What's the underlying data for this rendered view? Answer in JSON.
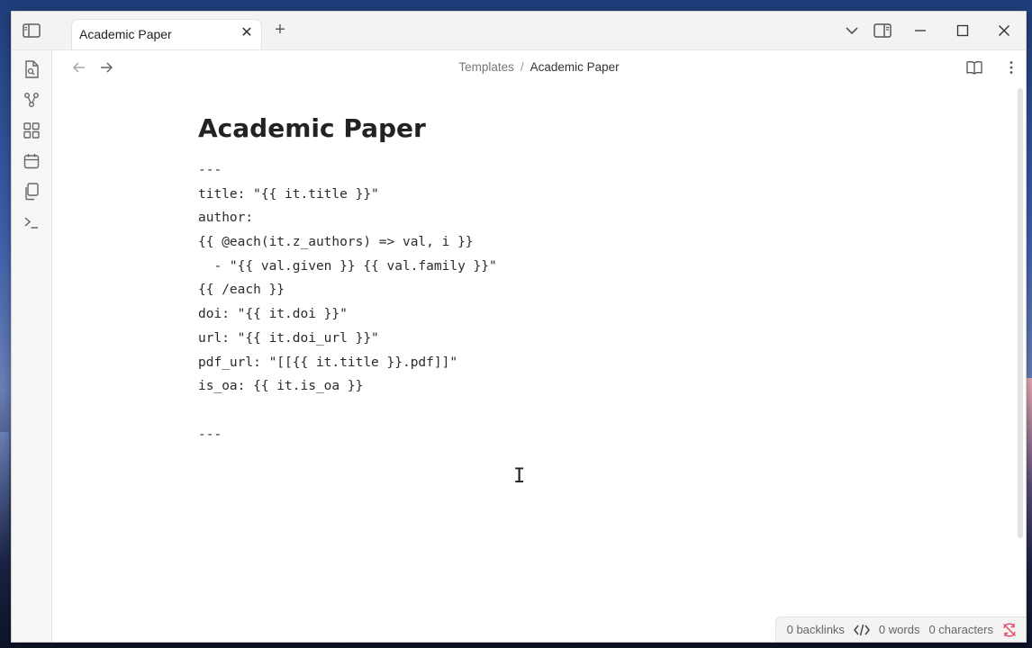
{
  "window": {
    "tab_title": "Academic Paper",
    "tab_close_glyph": "✕",
    "new_tab_glyph": "+"
  },
  "navigation": {
    "breadcrumb": {
      "parent": "Templates",
      "separator": "/",
      "current": "Academic Paper"
    }
  },
  "document": {
    "title": "Academic Paper",
    "lines": [
      "---",
      "title: \"{{ it.title }}\"",
      "author:",
      "{{ @each(it.z_authors) => val, i }}",
      "  - \"{{ val.given }} {{ val.family }}\"",
      "{{ /each }}",
      "doi: \"{{ it.doi }}\"",
      "url: \"{{ it.doi_url }}\"",
      "pdf_url: \"[[{{ it.title }}.pdf]]\"",
      "is_oa: {{ it.is_oa }}",
      "",
      "---"
    ]
  },
  "statusbar": {
    "backlinks": "0 backlinks",
    "words": "0 words",
    "characters": "0 characters"
  },
  "icons": {
    "ribbon": [
      "open-file-icon",
      "graph-icon",
      "canvas-icon",
      "calendar-icon",
      "copy-icon",
      "terminal-icon"
    ],
    "titlebar": [
      "sidebar-toggle-icon",
      "dropdown-chevron-icon",
      "right-sidebar-icon",
      "minimize-icon",
      "maximize-icon",
      "close-window-icon"
    ]
  }
}
